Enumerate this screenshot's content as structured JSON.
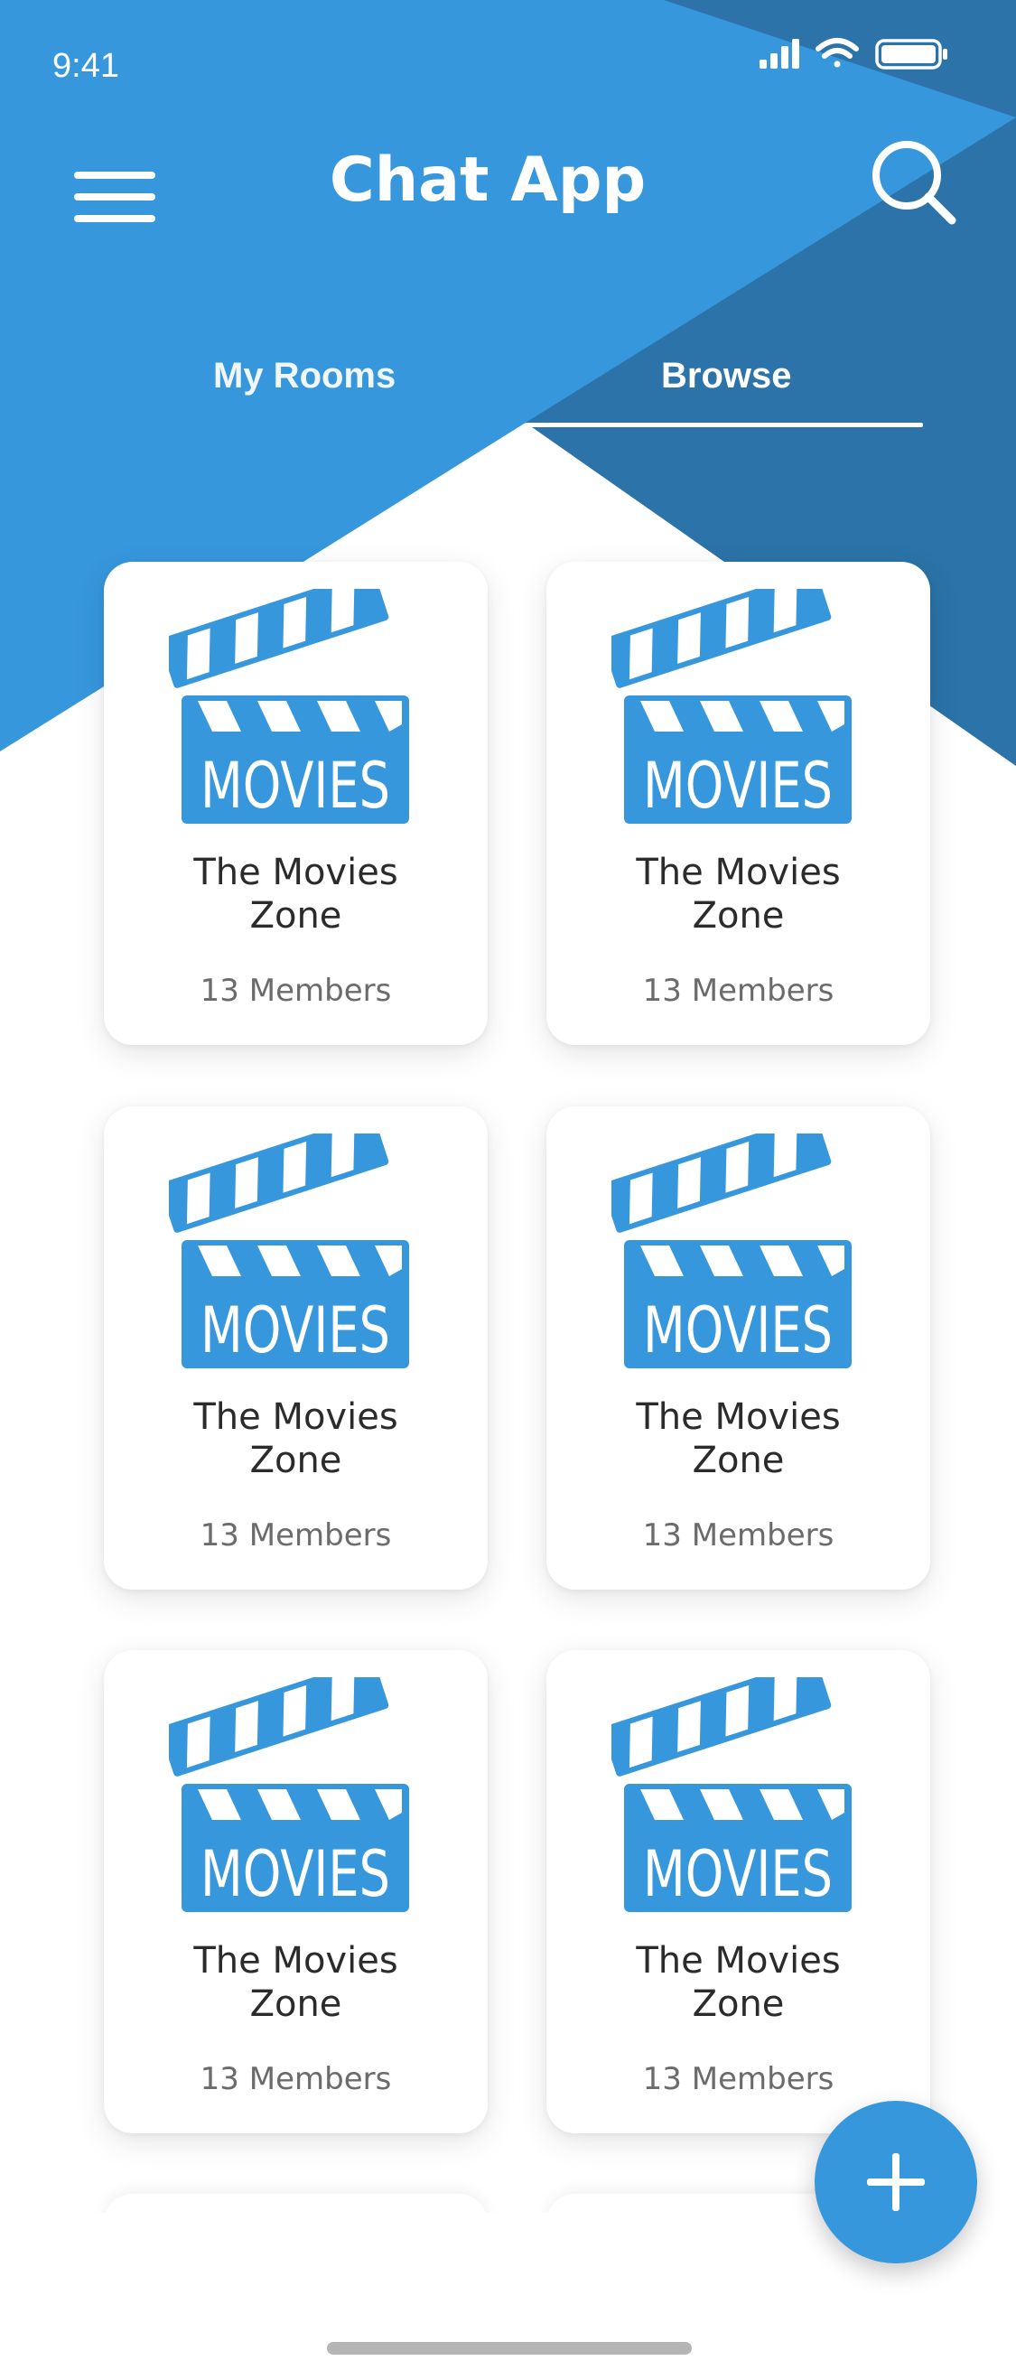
{
  "status_bar": {
    "time": "9:41",
    "icons": [
      "signal-icon",
      "wifi-icon",
      "battery-icon"
    ]
  },
  "header": {
    "title": "Chat App",
    "menu_icon": "hamburger-menu-icon",
    "search_icon": "search-icon"
  },
  "tabs": [
    {
      "label": "My Rooms",
      "active": false
    },
    {
      "label": "Browse",
      "active": true
    }
  ],
  "rooms": [
    {
      "logo_text": "MOVIES",
      "title_line1": "The Movies",
      "title_line2": "Zone",
      "members": "13 Members"
    },
    {
      "logo_text": "MOVIES",
      "title_line1": "The Movies",
      "title_line2": "Zone",
      "members": "13 Members"
    },
    {
      "logo_text": "MOVIES",
      "title_line1": "The Movies",
      "title_line2": "Zone",
      "members": "13 Members"
    },
    {
      "logo_text": "MOVIES",
      "title_line1": "The Movies",
      "title_line2": "Zone",
      "members": "13 Members"
    },
    {
      "logo_text": "MOVIES",
      "title_line1": "The Movies",
      "title_line2": "Zone",
      "members": "13 Members"
    },
    {
      "logo_text": "MOVIES",
      "title_line1": "The Movies",
      "title_line2": "Zone",
      "members": "13 Members"
    }
  ],
  "fab": {
    "icon": "plus-icon"
  },
  "colors": {
    "primary": "#3797dc",
    "primary_dark": "#2b73a8",
    "text_dark": "#2b2b2b",
    "text_muted": "#6b6b6b",
    "white": "#ffffff"
  }
}
